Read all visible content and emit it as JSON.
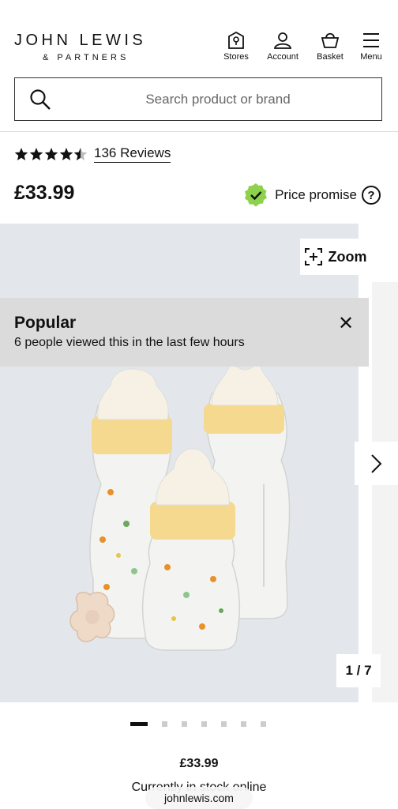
{
  "header": {
    "brand_line1": "JOHN LEWIS",
    "brand_line2": "& PARTNERS",
    "nav": [
      {
        "label": "Stores",
        "icon": "store-icon"
      },
      {
        "label": "Account",
        "icon": "account-icon"
      },
      {
        "label": "Basket",
        "icon": "basket-icon"
      },
      {
        "label": "Menu",
        "icon": "menu-icon"
      }
    ]
  },
  "search": {
    "placeholder": "Search product or brand"
  },
  "product": {
    "rating": 4.5,
    "reviews_label": "136 Reviews",
    "price": "£33.99",
    "promise_label": "Price promise"
  },
  "gallery": {
    "zoom_label": "Zoom",
    "popular_title": "Popular",
    "popular_text": "6 people viewed this in the last few hours",
    "counter": "1 / 7",
    "total_images": 7,
    "current_image": 1
  },
  "footer": {
    "price": "£33.99",
    "stock": "Currently in stock online",
    "url": "johnlewis.com"
  }
}
